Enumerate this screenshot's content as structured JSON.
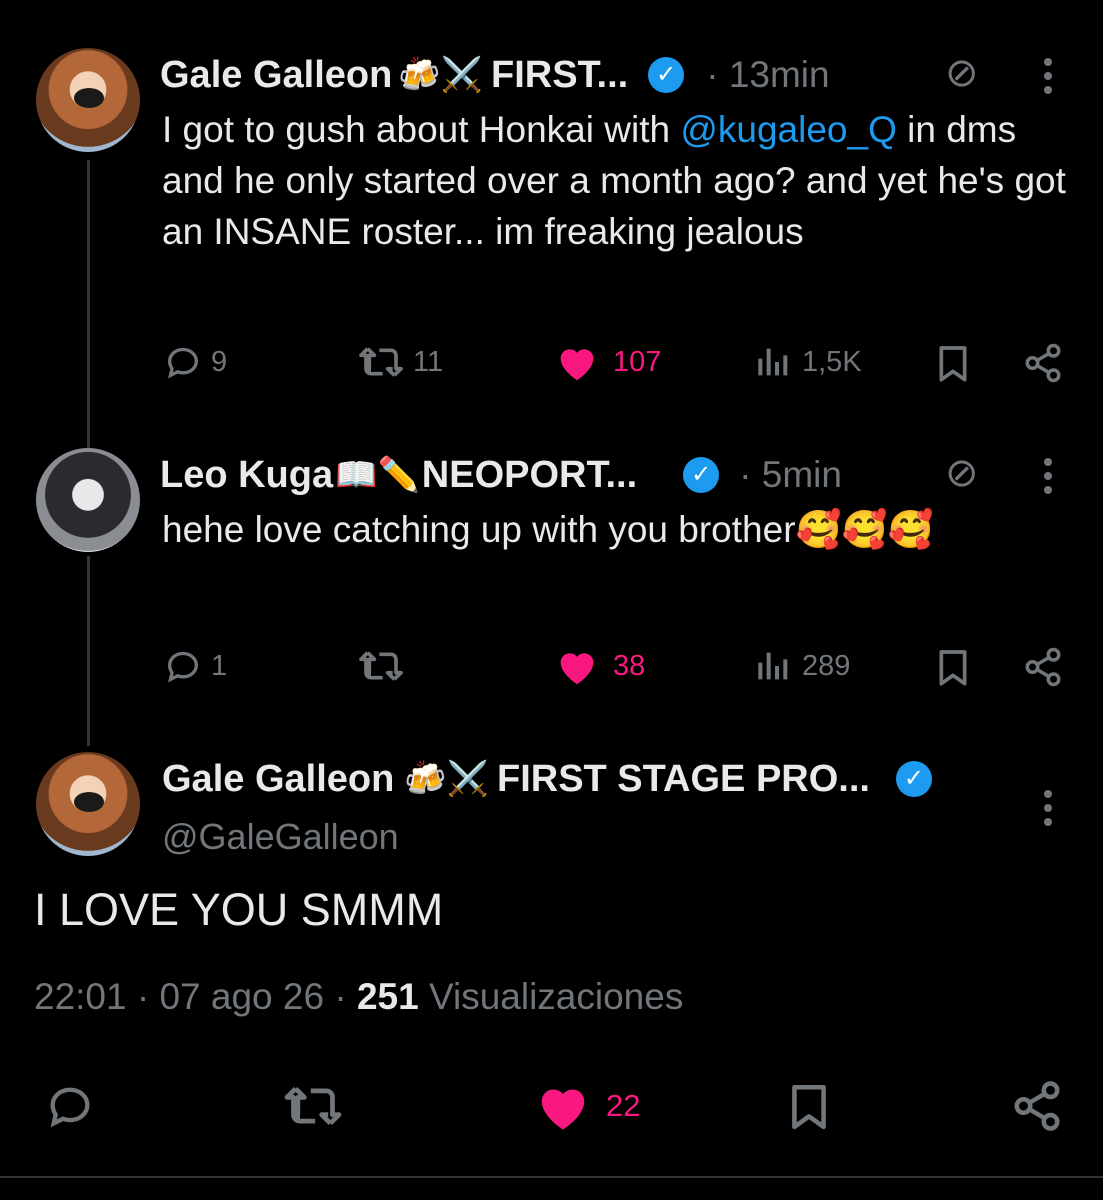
{
  "replies": [
    {
      "author": "Gale Galleon",
      "emoji": "🍻⚔️",
      "name_tail": "FIRST...",
      "time": "· 13min",
      "text_before": "I got to gush about Honkai with ",
      "mention": "@kugaleo_Q",
      "text_after": " in dms and he only started over a month ago? and yet he's got an INSANE roster... im freaking jealous",
      "replies": "9",
      "reposts": "11",
      "likes": "107",
      "views": "1,5K"
    },
    {
      "author": "Leo Kuga",
      "emoji": "📖✏️",
      "name_tail": "NEOPORT...",
      "time": "· 5min",
      "text": "hehe love catching up with you brother🥰🥰🥰",
      "replies": "1",
      "likes": "38",
      "views": "289"
    }
  ],
  "main": {
    "author": "Gale Galleon",
    "emoji": "🍻⚔️",
    "name_tail": "FIRST STAGE PRO...",
    "handle": "@GaleGalleon",
    "text": "I LOVE YOU SMMM",
    "time": "22:01 · 07 ago 26 · ",
    "views_count": "251",
    "views_label": " Visualizaciones",
    "likes": "22"
  },
  "colors": {
    "accent": "#1d9bf0",
    "like": "#f91880",
    "muted": "#71767b"
  }
}
